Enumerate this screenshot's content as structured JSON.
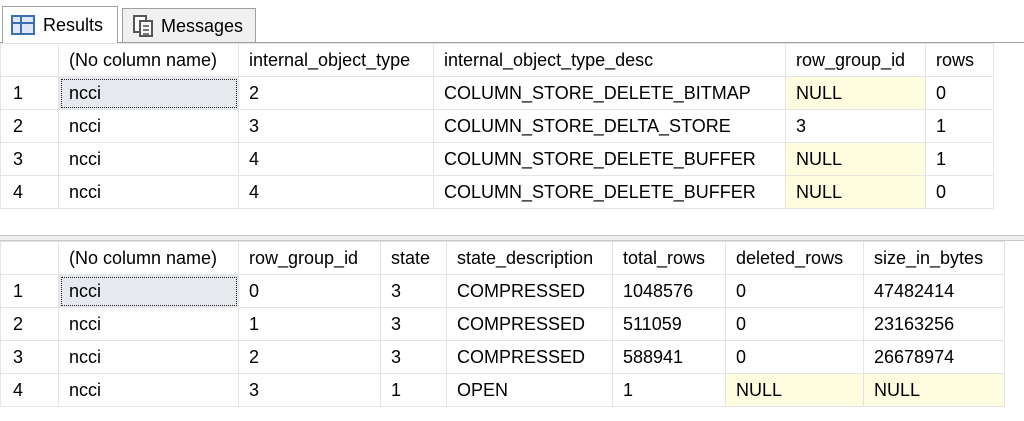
{
  "tabs": {
    "results_label": "Results",
    "messages_label": "Messages"
  },
  "grid1": {
    "columns": [
      "(No column name)",
      "internal_object_type",
      "internal_object_type_desc",
      "row_group_id",
      "rows"
    ],
    "rows": [
      [
        "1",
        "ncci",
        "2",
        "COLUMN_STORE_DELETE_BITMAP",
        "NULL",
        "0"
      ],
      [
        "2",
        "ncci",
        "3",
        "COLUMN_STORE_DELTA_STORE",
        "3",
        "1"
      ],
      [
        "3",
        "ncci",
        "4",
        "COLUMN_STORE_DELETE_BUFFER",
        "NULL",
        "1"
      ],
      [
        "4",
        "ncci",
        "4",
        "COLUMN_STORE_DELETE_BUFFER",
        "NULL",
        "0"
      ]
    ]
  },
  "grid2": {
    "columns": [
      "(No column name)",
      "row_group_id",
      "state",
      "state_description",
      "total_rows",
      "deleted_rows",
      "size_in_bytes"
    ],
    "rows": [
      [
        "1",
        "ncci",
        "0",
        "3",
        "COMPRESSED",
        "1048576",
        "0",
        "47482414"
      ],
      [
        "2",
        "ncci",
        "1",
        "3",
        "COMPRESSED",
        "511059",
        "0",
        "23163256"
      ],
      [
        "3",
        "ncci",
        "2",
        "3",
        "COMPRESSED",
        "588941",
        "0",
        "26678974"
      ],
      [
        "4",
        "ncci",
        "3",
        "1",
        "OPEN",
        "1",
        "NULL",
        "NULL"
      ]
    ]
  },
  "colors": {
    "null_cell": "#fffde0",
    "selected_cell": "#e6e9ee",
    "grid_line": "#e4e4e4"
  },
  "icons": {
    "results_tab": "results-grid-icon",
    "messages_tab": "messages-icon"
  }
}
